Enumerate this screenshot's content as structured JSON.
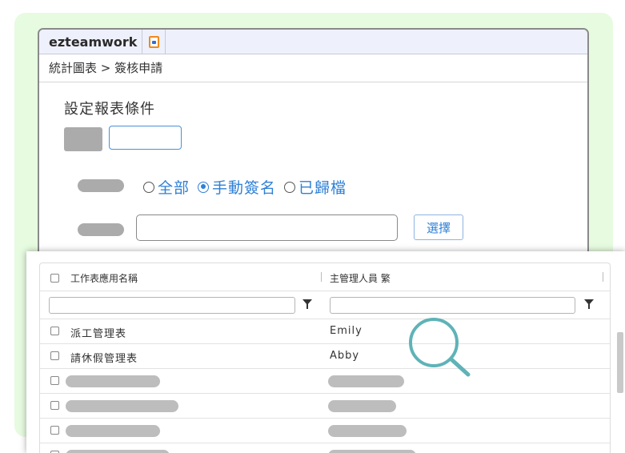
{
  "app": {
    "brand": "ezteamwork",
    "breadcrumb": "統計圖表 > 簽核申請",
    "section_title": "設定報表條件"
  },
  "filters": {
    "radio_options": [
      {
        "label": "全部",
        "checked": false
      },
      {
        "label": "手動簽名",
        "checked": true
      },
      {
        "label": "已歸檔",
        "checked": false
      }
    ],
    "select_button": "選擇"
  },
  "grid": {
    "columns": [
      "工作表應用名稱",
      "主管理人員 繁"
    ],
    "rows": [
      {
        "name": "派工管理表",
        "manager": "Emily"
      },
      {
        "name": "請休假管理表",
        "manager": "Abby"
      }
    ]
  },
  "colors": {
    "accent": "#2f80d6",
    "background_panel": "#e6fbe0",
    "magnifier": "#5fb3b7"
  },
  "icons": [
    "app-document-icon",
    "funnel-filter-icon",
    "magnifier-icon"
  ]
}
